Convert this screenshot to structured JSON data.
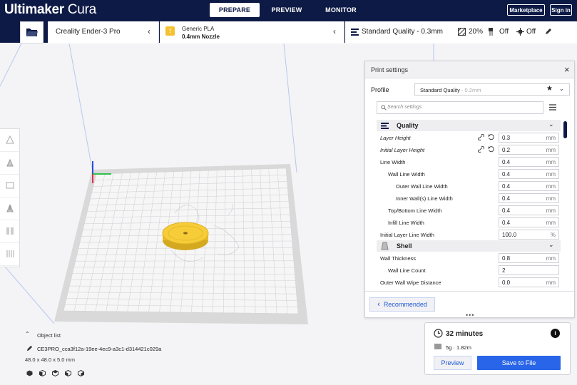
{
  "brand": {
    "bold": "Ultimaker",
    "light": "Cura"
  },
  "nav": {
    "prepare": "PREPARE",
    "preview": "PREVIEW",
    "monitor": "MONITOR"
  },
  "header_buttons": {
    "marketplace": "Marketplace",
    "signin": "Sign in"
  },
  "printer": {
    "name": "Creality Ender-3 Pro"
  },
  "material": {
    "name": "Generic PLA",
    "nozzle": "0.4mm Nozzle",
    "badge": "!"
  },
  "quality_bar": {
    "profile": "Standard Quality - 0.3mm",
    "infill": "20%",
    "support": "Off",
    "adhesion": "Off"
  },
  "print_settings": {
    "title": "Print settings",
    "profile_label": "Profile",
    "profile_value": "Standard Quality",
    "profile_suffix": " - 0.2mm",
    "search_placeholder": "Search settings",
    "categories": [
      {
        "name": "Quality"
      },
      {
        "name": "Shell"
      }
    ],
    "rows": [
      {
        "label": "Layer Height",
        "value": "0.3",
        "unit": "mm"
      },
      {
        "label": "Initial Layer Height",
        "value": "0.2",
        "unit": "mm"
      },
      {
        "label": "Line Width",
        "value": "0.4",
        "unit": "mm"
      },
      {
        "label": "Wall Line Width",
        "value": "0.4",
        "unit": "mm"
      },
      {
        "label": "Outer Wall Line Width",
        "value": "0.4",
        "unit": "mm"
      },
      {
        "label": "Inner Wall(s) Line Width",
        "value": "0.4",
        "unit": "mm"
      },
      {
        "label": "Top/Bottom Line Width",
        "value": "0.4",
        "unit": "mm"
      },
      {
        "label": "Infill Line Width",
        "value": "0.4",
        "unit": "mm"
      },
      {
        "label": "Initial Layer Line Width",
        "value": "100.0",
        "unit": "%"
      },
      {
        "label": "Wall Thickness",
        "value": "0.8",
        "unit": "mm"
      },
      {
        "label": "Wall Line Count",
        "value": "2",
        "unit": ""
      },
      {
        "label": "Outer Wall Wipe Distance",
        "value": "0.0",
        "unit": "mm"
      }
    ],
    "recommended_label": "Recommended"
  },
  "object_list": {
    "title": "Object list",
    "filename": "CE3PRO_cca3f12a-19ee-4ec9-a3c1-d314421c029a",
    "dimensions": "48.0 x 48.0 x 5.0 mm"
  },
  "estimate": {
    "time": "32 minutes",
    "material": "5g · 1.82m",
    "preview_label": "Preview",
    "save_label": "Save to File"
  },
  "colors": {
    "header": "#0d1a45",
    "accent": "#2965e8",
    "model": "#f6cc39"
  }
}
